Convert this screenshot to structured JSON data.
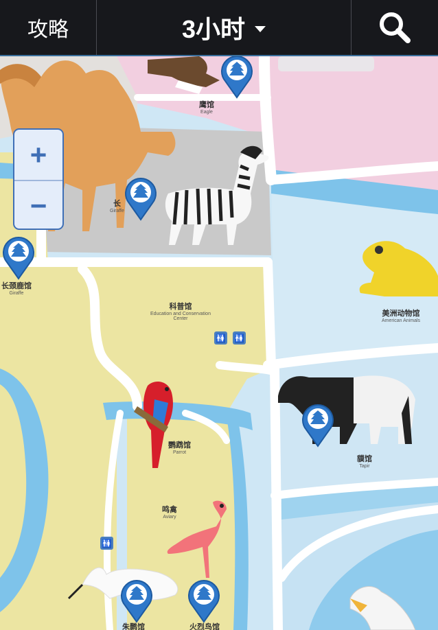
{
  "header": {
    "guide_label": "攻略",
    "duration_label": "3小时",
    "caret_icon": "chevron-down-icon",
    "search_icon": "search-icon"
  },
  "zoom": {
    "in_label": "+",
    "out_label": "−"
  },
  "map": {
    "labels": {
      "eagle": {
        "zh": "鹰馆",
        "en": "Eagle"
      },
      "giraffe": {
        "zh": "长",
        "en": "Giraffe"
      },
      "deer": {
        "zh": "长颈鹿馆",
        "en": "Giraffe"
      },
      "education": {
        "zh": "科普馆",
        "en": "Education and Conservation Center"
      },
      "amphibian": {
        "zh": "美洲动物馆",
        "en": "American Animals"
      },
      "parrot": {
        "zh": "鹦鹉馆",
        "en": "Parrot"
      },
      "tapir": {
        "zh": "貘馆",
        "en": "Tapir"
      },
      "aviary": {
        "zh": "鸣禽",
        "en": "Aviary"
      },
      "crane": {
        "zh": "朱鹮馆",
        "en": ""
      },
      "flamingo": {
        "zh": "火烈鸟馆",
        "en": ""
      }
    },
    "restroom_symbol": "🚻",
    "colors": {
      "water": "#7ec3ea",
      "pink_zone": "#f2cfe0",
      "green_zone": "#ece5a2",
      "gray_zone": "#c4c4c4",
      "light_blue": "#cfe7f5",
      "road": "#ffffff",
      "pin": "#2f78c9",
      "header": "#17181c"
    }
  }
}
